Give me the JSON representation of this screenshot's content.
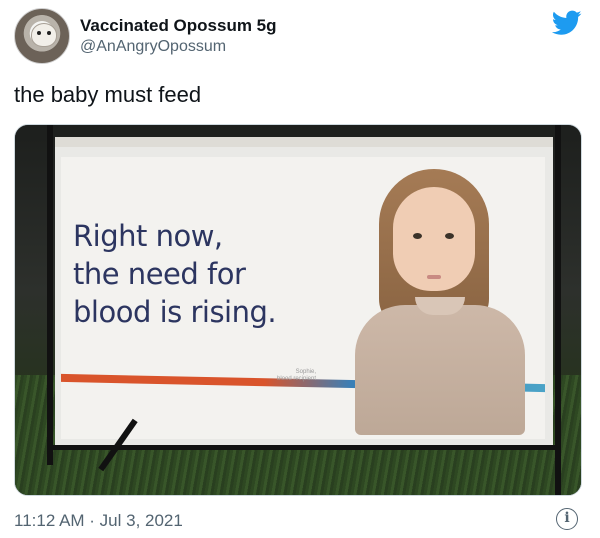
{
  "tweet": {
    "display_name": "Vaccinated Opossum 5g",
    "handle": "@AnAngryOpossum",
    "text": "the baby must feed",
    "timestamp": "11:12 AM · Jul 3, 2021"
  },
  "photo": {
    "sign_lines": [
      "Right now,",
      "the need for",
      "blood is rising."
    ],
    "credit_lines": [
      "Sophie,",
      "blood recipient"
    ]
  },
  "icons": {
    "brand": "twitter-bird-icon",
    "info": "info-icon",
    "brand_color": "#1d9bf0",
    "info_glyph": "i"
  },
  "colors": {
    "name_text": "#0f1419",
    "secondary_text": "#536471",
    "sign_text": "#2c3560"
  }
}
